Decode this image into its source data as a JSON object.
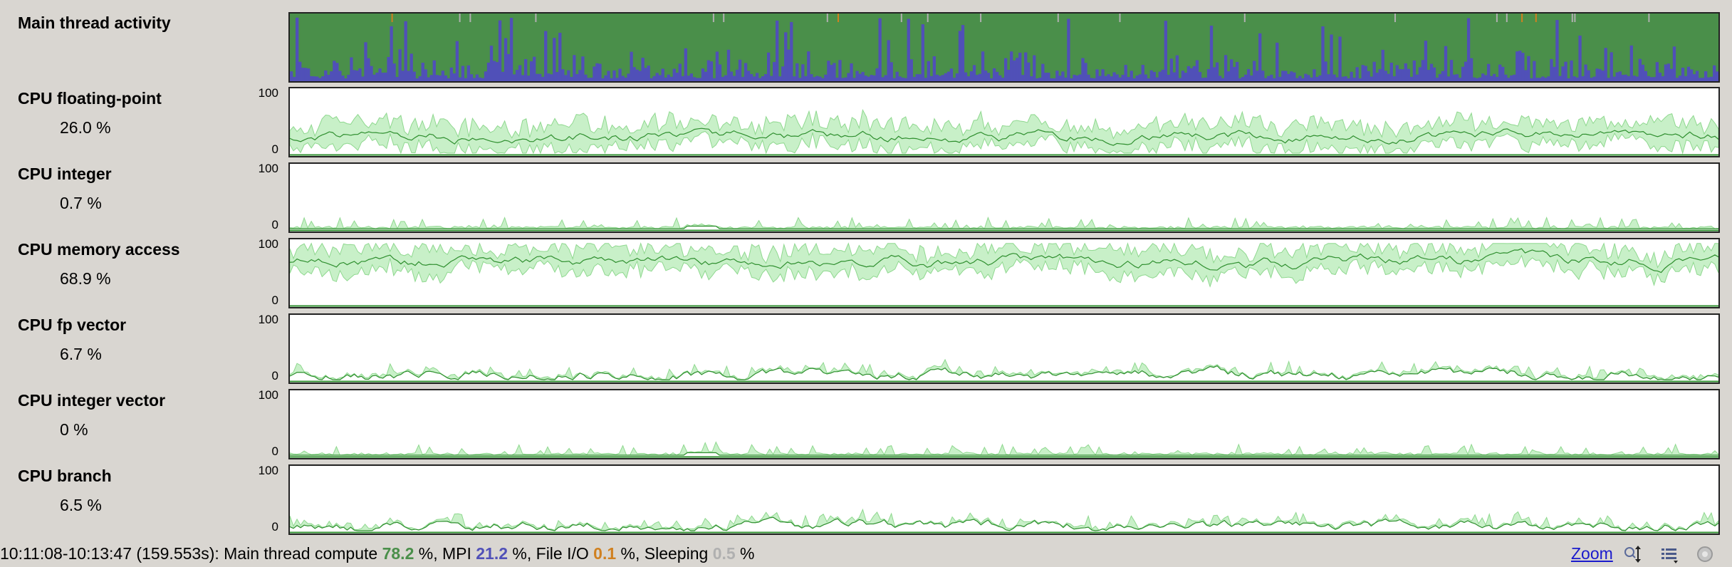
{
  "rows": [
    {
      "label": "Main thread activity",
      "value": null
    },
    {
      "label": "CPU floating-point",
      "value": "26.0 %",
      "max": "100",
      "min": "0",
      "level": 26.0,
      "baseline": 0.28
    },
    {
      "label": "CPU integer",
      "value": "0.7 %",
      "max": "100",
      "min": "0",
      "level": 0.7,
      "baseline": 0.02
    },
    {
      "label": "CPU memory access",
      "value": "68.9 %",
      "max": "100",
      "min": "0",
      "level": 68.9,
      "baseline": 0.68
    },
    {
      "label": "CPU fp vector",
      "value": "6.7 %",
      "max": "100",
      "min": "0",
      "level": 6.7,
      "baseline": 0.08
    },
    {
      "label": "CPU integer vector",
      "value": "0 %",
      "max": "100",
      "min": "0",
      "level": 0.0,
      "baseline": 0.0
    },
    {
      "label": "CPU branch",
      "value": "6.5 %",
      "max": "100",
      "min": "0",
      "level": 6.5,
      "baseline": 0.07
    }
  ],
  "status": {
    "range": "10:11:08-10:13:47 (159.553s): Main thread compute ",
    "compute_pct": "78.2",
    "mpi_text": " %, MPI ",
    "mpi_pct": "21.2",
    "fileio_text": " %, File I/O ",
    "fileio_pct": "0.1",
    "sleeping_text": " %, Sleeping ",
    "sleeping_pct": "0.5",
    "end_text": " %"
  },
  "toolbar": {
    "zoom_label": "Zoom"
  },
  "colors": {
    "compute": "#4a8f4a",
    "mpi": "#5050b8",
    "fileio": "#d08020",
    "sleeping": "#b0b0b0",
    "fill_light": "#c8f0c8",
    "fill_mid": "#8fd88f",
    "line": "#2f8f2f"
  }
}
